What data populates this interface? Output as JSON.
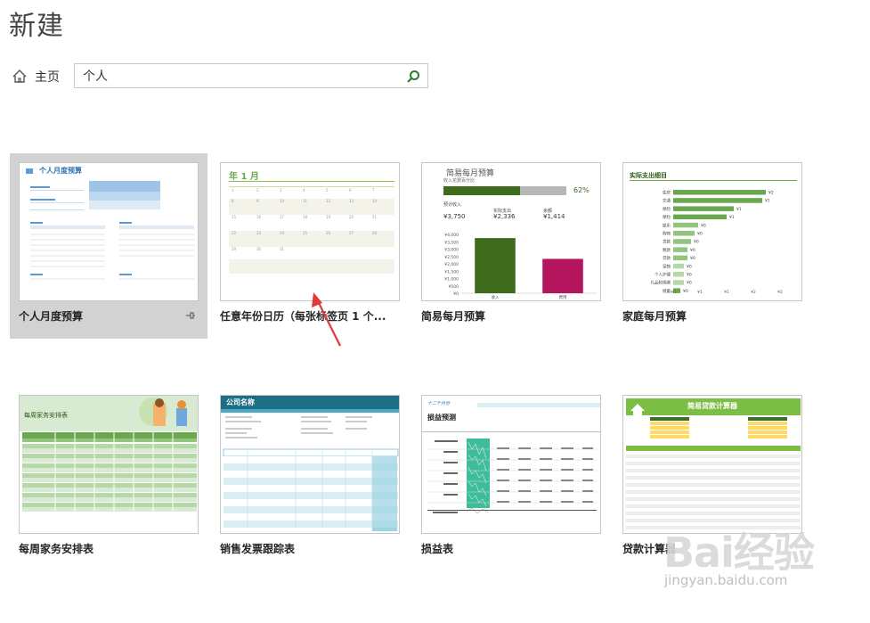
{
  "header": {
    "title": "新建"
  },
  "nav": {
    "home_label": "主页",
    "search_value": "个人"
  },
  "tiles": [
    {
      "name": "个人月度预算"
    },
    {
      "name": "任意年份日历（每张标签页 1 个..."
    },
    {
      "name": "简易每月预算"
    },
    {
      "name": "家庭每月预算"
    },
    {
      "name": "每周家务安排表"
    },
    {
      "name": "销售发票跟踪表"
    },
    {
      "name": "损益表"
    },
    {
      "name": "贷款计算器"
    }
  ],
  "thumbs": {
    "personal": {
      "heading": "个人月度预算"
    },
    "calendar": {
      "heading": "年 1 月"
    },
    "simple": {
      "heading": "简易每月预算",
      "sub": "收入花费百分比",
      "pct": "62%",
      "labels": [
        "预计收入",
        "实际支出",
        "余额"
      ],
      "values": [
        "¥3,750",
        "¥2,336",
        "¥1,414"
      ],
      "bar_fraction": 0.62,
      "chart_data": {
        "type": "bar",
        "categories": [
          "收入",
          "费用"
        ],
        "values": [
          3750,
          2336
        ],
        "ylim": [
          0,
          4000
        ],
        "yticks": [
          "¥4,000",
          "¥3,500",
          "¥3,000",
          "¥2,500",
          "¥2,000",
          "¥1,500",
          "¥1,000",
          "¥500",
          "¥0"
        ],
        "colors": [
          "#3f6b1d",
          "#b5155d"
        ]
      }
    },
    "family": {
      "heading": "实际支出细目",
      "chart_data": {
        "type": "bar",
        "categories": [
          "住房",
          "交通",
          "保险",
          "保险",
          "娱乐",
          "购物",
          "货款",
          "税款",
          "贷款",
          "宠物",
          "个人护理",
          "礼品和捐赠",
          "储蓄"
        ],
        "values": [
          2.6,
          2.5,
          1.7,
          1.5,
          0.7,
          0.6,
          0.5,
          0.4,
          0.4,
          0.3,
          0.3,
          0.3,
          0.2
        ],
        "value_labels": [
          "¥2",
          "¥1",
          "¥1",
          "¥1",
          "¥0",
          "¥0",
          "¥0",
          "¥0",
          "¥0",
          "¥0",
          "¥0",
          "¥0",
          "¥0"
        ],
        "xticks": [
          "¥0",
          "¥1",
          "¥1",
          "¥2",
          "¥2"
        ],
        "colors": [
          "#6aa84f",
          "#93c47d",
          "#b6d7a8"
        ]
      }
    },
    "chores": {
      "heading": "每周家务安排表"
    },
    "invoice": {
      "heading": "公司名称"
    },
    "pl": {
      "date": "十二个月份",
      "heading": "损益预测"
    },
    "loan": {
      "heading": "简易贷款计算器"
    }
  },
  "colors": {
    "accent": "#2e7d32",
    "selected_tile": "#d2d2d2",
    "arrow": "#e0393c"
  },
  "watermark": {
    "logo": "Bai经验",
    "url": "jingyan.baidu.com"
  }
}
